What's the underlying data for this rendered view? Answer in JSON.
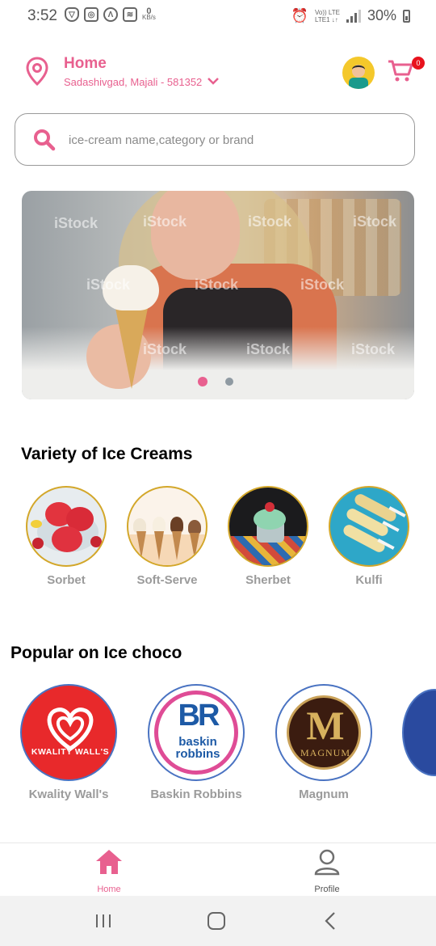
{
  "status_bar": {
    "time": "3:52",
    "speed_value": "0",
    "speed_unit": "KB/s",
    "network_top": "Vo)) LTE",
    "network_bottom": "LTE1 ↓↑",
    "battery": "30%"
  },
  "header": {
    "location_title": "Home",
    "location_address": "Sadashivgad, Majali - 581352",
    "cart_count": "0"
  },
  "search": {
    "placeholder": "ice-cream name,category or brand"
  },
  "banner": {
    "watermark": "iStock",
    "active_slide": 1,
    "total_slides": 2
  },
  "varieties": {
    "title": "Variety of Ice Creams",
    "items": [
      {
        "label": "Sorbet"
      },
      {
        "label": "Soft-Serve"
      },
      {
        "label": "Sherbet"
      },
      {
        "label": "Kulfi"
      }
    ]
  },
  "popular": {
    "title": "Popular on Ice choco",
    "items": [
      {
        "label": "Kwality Wall's",
        "logo_text": "KWALITY WALL'S"
      },
      {
        "label": "Baskin Robbins",
        "logo_text_top": "BR",
        "logo_text_bottom": "baskin robbins"
      },
      {
        "label": "Magnum",
        "logo_text_top": "M",
        "logo_text_bottom": "MAGNUM"
      }
    ]
  },
  "bottom_nav": {
    "home_label": "Home",
    "profile_label": "Profile"
  },
  "colors": {
    "accent": "#e8608f",
    "category_border": "#d3a72a",
    "brand_border": "#4a73c2",
    "inactive": "#9b9b9b"
  }
}
